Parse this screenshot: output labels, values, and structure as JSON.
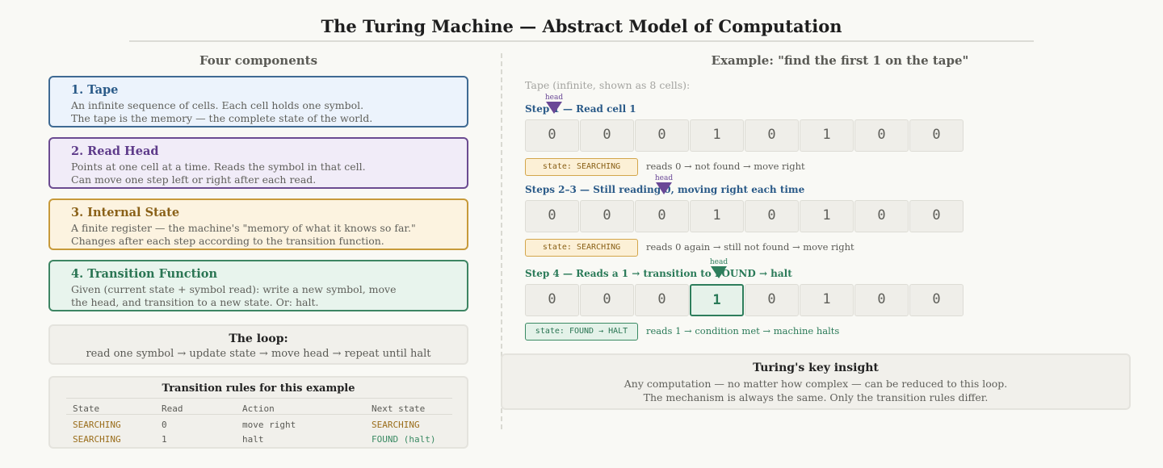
{
  "title": "The Turing Machine — Abstract Model of Computation",
  "left": {
    "heading": "Four components",
    "components": [
      {
        "title": "1. Tape",
        "lines": [
          "An infinite sequence of cells. Each cell holds one symbol.",
          "The tape is the memory — the complete state of the world."
        ],
        "color": "#2a5a88"
      },
      {
        "title": "2. Read Head",
        "lines": [
          "Points at one cell at a time. Reads the symbol in that cell.",
          "Can move one step left or right after each read."
        ],
        "color": "#5e3b8a"
      },
      {
        "title": "3. Internal State",
        "lines": [
          "A finite register — the machine's \"memory of what it knows so far.\"",
          "Changes after each step according to the transition function."
        ],
        "color": "#8a6118"
      },
      {
        "title": "4. Transition Function",
        "lines": [
          "Given (current state + symbol read): write a new symbol, move",
          "the head, and transition to a new state. Or: halt."
        ],
        "color": "#2a7553"
      }
    ],
    "loop": {
      "title": "The loop:",
      "text": "read one symbol → update state → move head → repeat until halt"
    },
    "rules": {
      "title": "Transition rules for this example",
      "headers": [
        "State",
        "Read",
        "Action",
        "Next state"
      ],
      "rows": [
        [
          "SEARCHING",
          "0",
          "move right",
          "SEARCHING"
        ],
        [
          "SEARCHING",
          "1",
          "halt",
          "FOUND (halt)"
        ]
      ]
    }
  },
  "right": {
    "heading": "Example: \"find the first 1 on the tape\"",
    "subtitle": "Tape (infinite, shown as 8 cells):",
    "head_label": "head",
    "steps": [
      {
        "label": "Step 1 — Read cell 1",
        "cells": [
          "0",
          "0",
          "0",
          "1",
          "0",
          "1",
          "0",
          "0"
        ],
        "head_index": 0,
        "state": "state: SEARCHING",
        "note": "reads 0 → not found → move right",
        "kind": "searching"
      },
      {
        "label": "Steps 2–3 — Still reading 0, moving right each time",
        "cells": [
          "0",
          "0",
          "0",
          "1",
          "0",
          "1",
          "0",
          "0"
        ],
        "head_index": 2,
        "state": "state: SEARCHING",
        "note": "reads 0 again → still not found → move right",
        "kind": "searching"
      },
      {
        "label": "Step 4 — Reads a 1 → transition to FOUND → halt",
        "cells": [
          "0",
          "0",
          "0",
          "1",
          "0",
          "1",
          "0",
          "0"
        ],
        "head_index": 3,
        "state": "state: FOUND → HALT",
        "note": "reads 1 → condition met → machine halts",
        "kind": "found"
      }
    ],
    "insight": {
      "title": "Turing's key insight",
      "lines": [
        "Any computation — no matter how complex — can be reduced to this loop.",
        "The mechanism is always the same. Only the transition rules differ."
      ]
    }
  }
}
